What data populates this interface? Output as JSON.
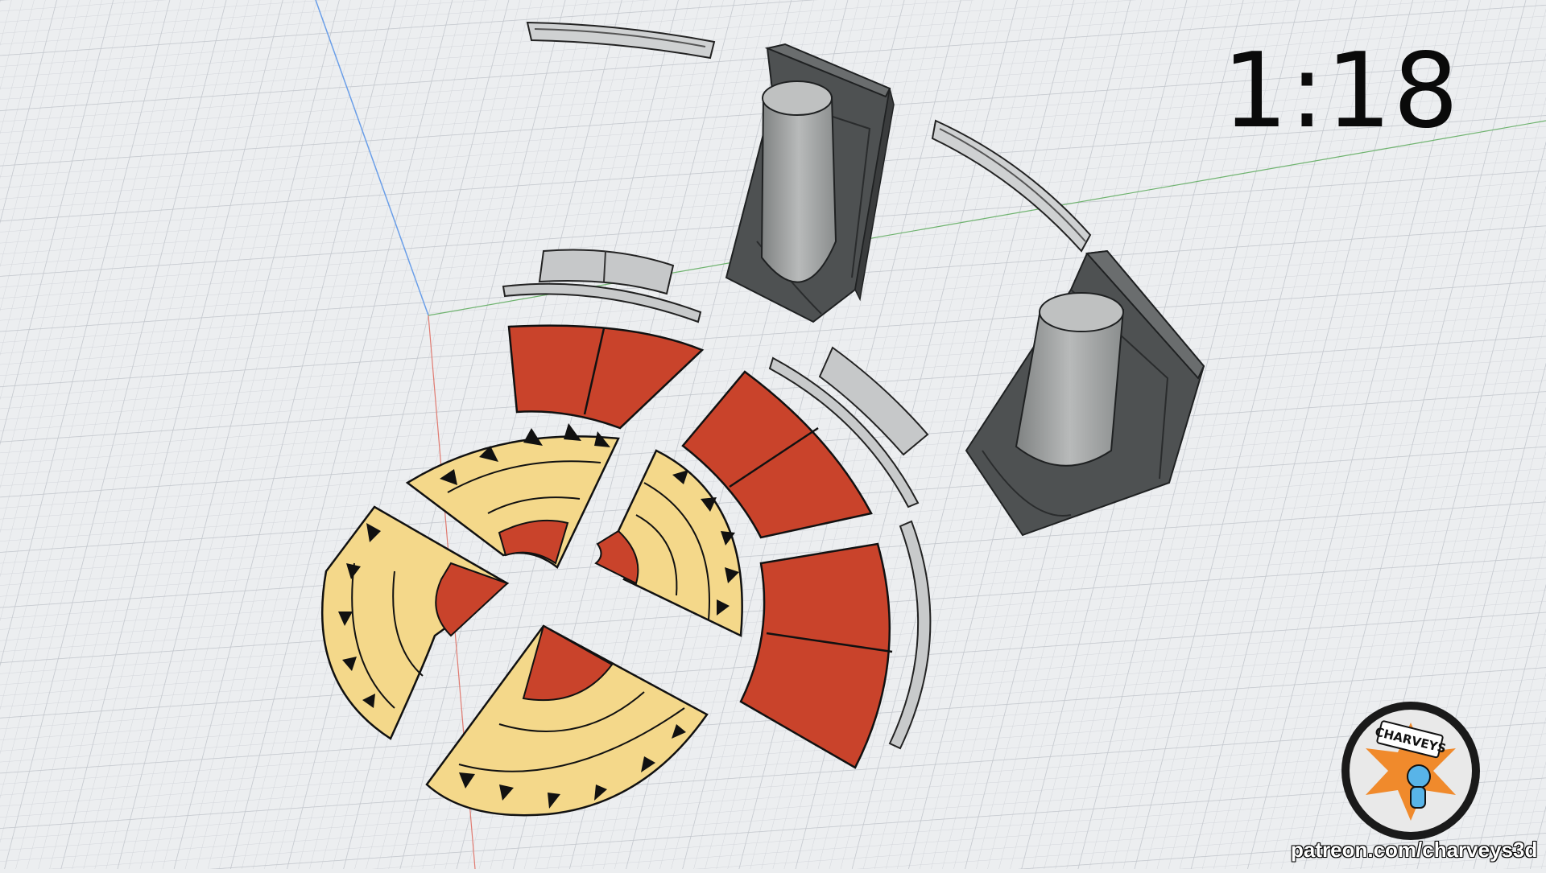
{
  "viewport": {
    "scale_label": "1:18",
    "watermark_url": "patreon.com/charveys3d",
    "logo_text": "CHARVEYS"
  },
  "colors": {
    "background": "#eceef0",
    "grid_line": "#c9ccd1",
    "axis_x": "#e07a70",
    "axis_y": "#6fb36f",
    "axis_z": "#6a9ee8",
    "terracotta": "#c9432b",
    "cream": "#f4d88a",
    "ornament": "#111111",
    "stone_dark": "#5a5d5e",
    "stone_cylinder": "#a9abab",
    "rail_gray": "#bcbfc1"
  },
  "icons": [
    "logo-badge-icon"
  ]
}
